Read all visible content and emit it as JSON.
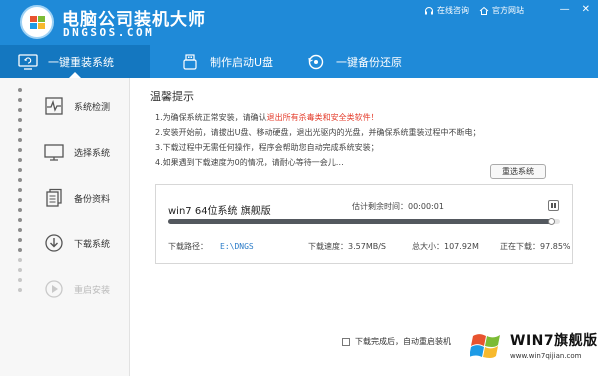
{
  "header": {
    "brand": "电脑公司装机大师",
    "domain": "DNGSOS.COM",
    "links": [
      {
        "label": "在线咨询",
        "icon": "headset-icon"
      },
      {
        "label": "官方网站",
        "icon": "house-icon"
      }
    ],
    "window_controls": {
      "minimize": "—",
      "close": "✕"
    },
    "colors": {
      "header_bg": "#1f8ad8",
      "active_tab_bg": "#1477c0"
    }
  },
  "tabs": [
    {
      "label": "一键重装系统",
      "icon": "monitor-refresh-icon",
      "active": true
    },
    {
      "label": "制作启动U盘",
      "icon": "usb-drive-icon",
      "active": false
    },
    {
      "label": "一键备份还原",
      "icon": "backup-restore-icon",
      "active": false
    }
  ],
  "sidebar": {
    "steps": [
      {
        "label": "系统检测",
        "icon": "pulse-check-icon",
        "state": "done"
      },
      {
        "label": "选择系统",
        "icon": "monitor-icon",
        "state": "done"
      },
      {
        "label": "备份资料",
        "icon": "documents-icon",
        "state": "done"
      },
      {
        "label": "下载系统",
        "icon": "download-circle-icon",
        "state": "current"
      },
      {
        "label": "重启安装",
        "icon": "restart-icon",
        "state": "pending"
      }
    ]
  },
  "main": {
    "tip_title": "温馨提示",
    "tips": [
      {
        "pre": "1.为确保系统正常安装，请确认",
        "highlight": "退出所有杀毒类和安全类软件！",
        "post": ""
      },
      {
        "pre": "2.安装开始前，请拔出U盘、移动硬盘，退出光驱内的光盘，并确保系统重装过程中不断电；",
        "highlight": "",
        "post": ""
      },
      {
        "pre": "3.下载过程中无需任何操作，程序会帮助您自动完成系统安装；",
        "highlight": "",
        "post": ""
      },
      {
        "pre": "4.如果遇到下载速度为0的情况，请耐心等待一会儿…",
        "highlight": "",
        "post": ""
      }
    ],
    "reselect_button": "重选系统",
    "download": {
      "system_name": "win7 64位系统 旗舰版",
      "remaining_label": "估计剩余时间：",
      "remaining_time": "00:00:01",
      "progress_percent": 97.85,
      "path_label": "下载路径：",
      "path_value": "E:\\DNGS",
      "speed_label": "下载速度：",
      "speed_value": "3.57MB/S",
      "size_label": "总大小：",
      "size_value": "107.92M",
      "status_label": "正在下载：",
      "status_value": "97.85%"
    },
    "auto_reboot_label": "下载完成后，自动重启装机",
    "auto_reboot_checked": false
  },
  "watermark": {
    "text": "WIN7旗舰版",
    "url": "www.win7qijian.com"
  }
}
